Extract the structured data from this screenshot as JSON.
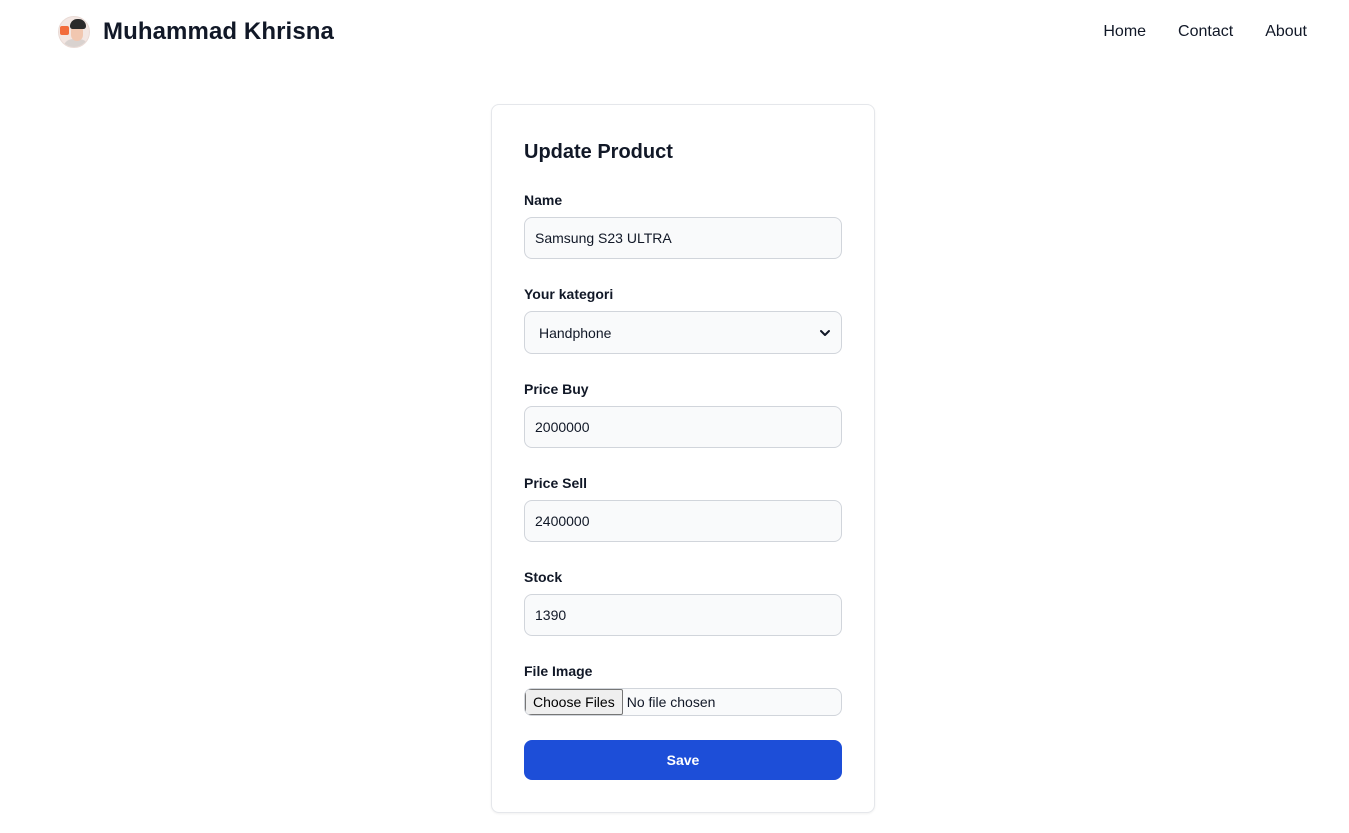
{
  "navbar": {
    "brand_name": "Muhammad Khrisna",
    "avatar_icon": "profile-photo",
    "links": [
      {
        "label": "Home"
      },
      {
        "label": "Contact"
      },
      {
        "label": "About"
      }
    ]
  },
  "form": {
    "title": "Update Product",
    "fields": {
      "name": {
        "label": "Name",
        "value": "Samsung S23 ULTRA"
      },
      "kategori": {
        "label": "Your kategori",
        "selected": "Handphone"
      },
      "price_buy": {
        "label": "Price Buy",
        "value": "2000000"
      },
      "price_sell": {
        "label": "Price Sell",
        "value": "2400000"
      },
      "stock": {
        "label": "Stock",
        "value": "1390"
      },
      "file_image": {
        "label": "File Image",
        "button_label": "Choose Files",
        "status": "No file chosen"
      }
    },
    "save_label": "Save"
  },
  "colors": {
    "accent": "#1d4ed8",
    "input_bg": "#f9fafb",
    "border": "#d1d5db"
  }
}
